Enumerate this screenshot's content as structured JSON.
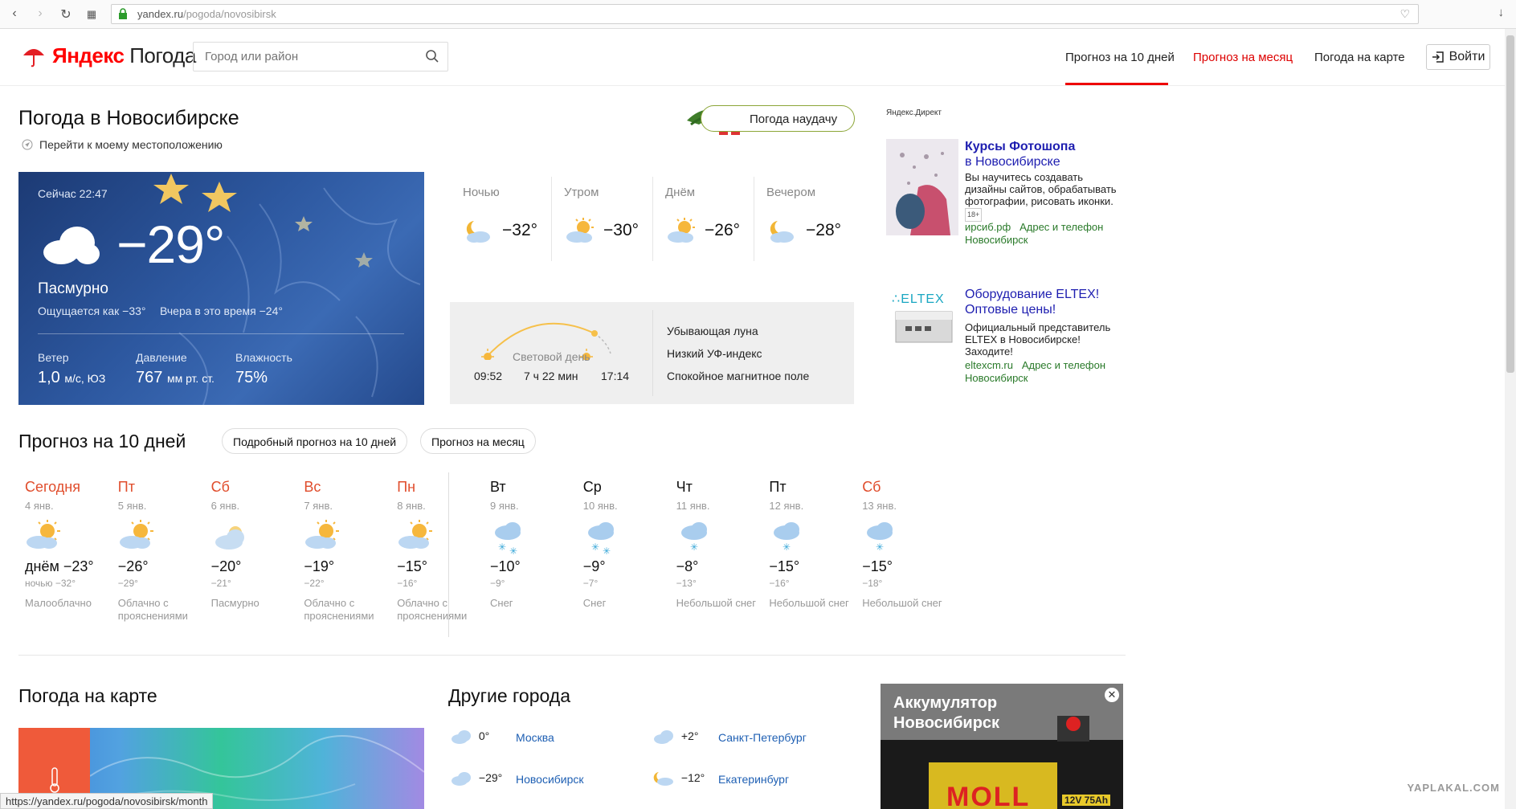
{
  "browser": {
    "url_host": "yandex.ru",
    "url_path": "/pogoda/novosibirsk"
  },
  "header": {
    "logo_brand": "Яндекс",
    "logo_product": "Погода",
    "search_placeholder": "Город или район",
    "nav": [
      "Прогноз на 10 дней",
      "Прогноз на месяц",
      "Погода на карте"
    ],
    "login": "Войти"
  },
  "title": "Погода в Новосибирске",
  "geo_link": "Перейти к моему местоположению",
  "luck_button": "Погода наудачу",
  "now": {
    "time": "Сейчас 22:47",
    "temp": "−29°",
    "condition": "Пасмурно",
    "feels": "Ощущается как −33°",
    "yesterday": "Вчера в это время −24°",
    "wind_label": "Ветер",
    "wind_value": "1,0",
    "wind_unit": "м/с, ЮЗ",
    "pressure_label": "Давление",
    "pressure_value": "767",
    "pressure_unit": "мм рт. ст.",
    "humidity_label": "Влажность",
    "humidity_value": "75%"
  },
  "dayparts": [
    {
      "name": "Ночью",
      "temp": "−32°"
    },
    {
      "name": "Утром",
      "temp": "−30°"
    },
    {
      "name": "Днём",
      "temp": "−26°"
    },
    {
      "name": "Вечером",
      "temp": "−28°"
    }
  ],
  "sun": {
    "label": "Световой день",
    "sunrise": "09:52",
    "length": "7 ч 22 мин",
    "sunset": "17:14",
    "moon": "Убывающая луна",
    "uv": "Низкий УФ-индекс",
    "magnetic": "Спокойное магнитное поле"
  },
  "ad1": {
    "label": "Яндекс.Директ",
    "title1": "Курсы Фотошопа",
    "title2": "в Новосибирске",
    "text": "Вы научитесь создавать дизайны сайтов, обрабатывать фотографии, рисовать иконки.",
    "age": "18+",
    "domain": "ирсиб.рф",
    "contact": "Адрес и телефон",
    "city": "Новосибирск"
  },
  "ad2": {
    "logo": "ELTEX",
    "title1": "Оборудование ELTEX!",
    "title2": "Оптовые цены!",
    "text": "Официальный представитель ELTEX в Новосибирске! Заходите!",
    "domain": "eltexcm.ru",
    "contact": "Адрес и телефон",
    "city": "Новосибирск"
  },
  "forecast": {
    "heading": "Прогноз на 10 дней",
    "btn_detail": "Подробный прогноз на 10 дней",
    "btn_month": "Прогноз на месяц",
    "days": [
      {
        "day": "Сегодня",
        "date": "4 янв.",
        "hi": "днём −23°",
        "lo": "ночью −32°",
        "cond": "Малооблачно",
        "weekend": true,
        "icon": "sun-cloud"
      },
      {
        "day": "Пт",
        "date": "5 янв.",
        "hi": "−26°",
        "lo": "−29°",
        "cond": "Облачно с прояснениями",
        "weekend": true,
        "icon": "sun-cloud"
      },
      {
        "day": "Сб",
        "date": "6 янв.",
        "hi": "−20°",
        "lo": "−21°",
        "cond": "Пасмурно",
        "weekend": true,
        "icon": "cloud"
      },
      {
        "day": "Вс",
        "date": "7 янв.",
        "hi": "−19°",
        "lo": "−22°",
        "cond": "Облачно с прояснениями",
        "weekend": true,
        "icon": "sun-cloud"
      },
      {
        "day": "Пн",
        "date": "8 янв.",
        "hi": "−15°",
        "lo": "−16°",
        "cond": "Облачно с прояснениями",
        "weekend": true,
        "icon": "sun-cloud"
      },
      {
        "day": "Вт",
        "date": "9 янв.",
        "hi": "−10°",
        "lo": "−9°",
        "cond": "Снег",
        "weekend": false,
        "icon": "snow"
      },
      {
        "day": "Ср",
        "date": "10 янв.",
        "hi": "−9°",
        "lo": "−7°",
        "cond": "Снег",
        "weekend": false,
        "icon": "snow"
      },
      {
        "day": "Чт",
        "date": "11 янв.",
        "hi": "−8°",
        "lo": "−13°",
        "cond": "Небольшой снег",
        "weekend": false,
        "icon": "light-snow"
      },
      {
        "day": "Пт",
        "date": "12 янв.",
        "hi": "−15°",
        "lo": "−16°",
        "cond": "Небольшой снег",
        "weekend": false,
        "icon": "light-snow"
      },
      {
        "day": "Сб",
        "date": "13 янв.",
        "hi": "−15°",
        "lo": "−18°",
        "cond": "Небольшой снег",
        "weekend": true,
        "icon": "light-snow"
      }
    ]
  },
  "map_heading": "Погода на карте",
  "cities_heading": "Другие города",
  "cities": [
    {
      "temp": "0°",
      "name": "Москва"
    },
    {
      "temp": "+2°",
      "name": "Санкт-Петербург"
    },
    {
      "temp": "−29°",
      "name": "Новосибирск"
    },
    {
      "temp": "−12°",
      "name": "Екатеринбург"
    }
  ],
  "banner": {
    "line1": "Аккумулятор",
    "line2": "Новосибирск",
    "brand": "MOLL",
    "spec": "12V 75Ah"
  },
  "status_url": "https://yandex.ru/pogoda/novosibirsk/month",
  "watermark": "YAPLAKAL.COM"
}
